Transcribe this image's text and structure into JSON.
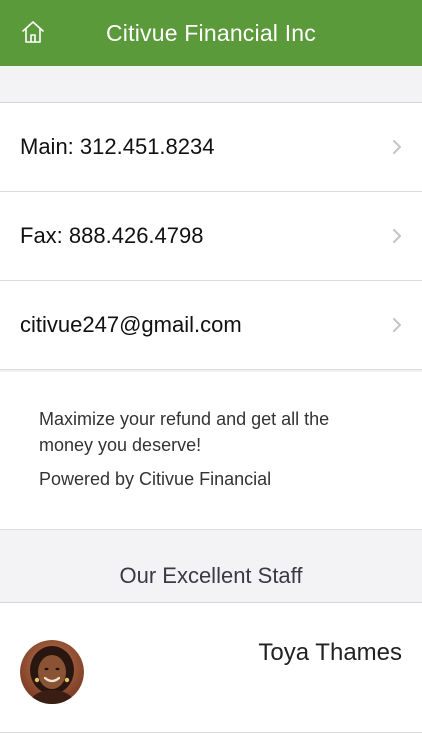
{
  "header": {
    "title": "Citivue Financial Inc",
    "home_icon": "home-icon",
    "bar_color": "#5b9a3a"
  },
  "contacts": [
    {
      "label": "Main: 312.451.8234",
      "icon": "chevron-right-icon"
    },
    {
      "label": "Fax: 888.426.4798",
      "icon": "chevron-right-icon"
    },
    {
      "label": "citivue247@gmail.com",
      "icon": "chevron-right-icon"
    }
  ],
  "info": {
    "description": "Maximize your refund and get all the money you deserve!",
    "powered_by": "Powered by Citivue Financial"
  },
  "staff": {
    "section_title": "Our Excellent Staff",
    "members": [
      {
        "name": "Toya Thames",
        "avatar": "avatar-photo"
      }
    ]
  }
}
